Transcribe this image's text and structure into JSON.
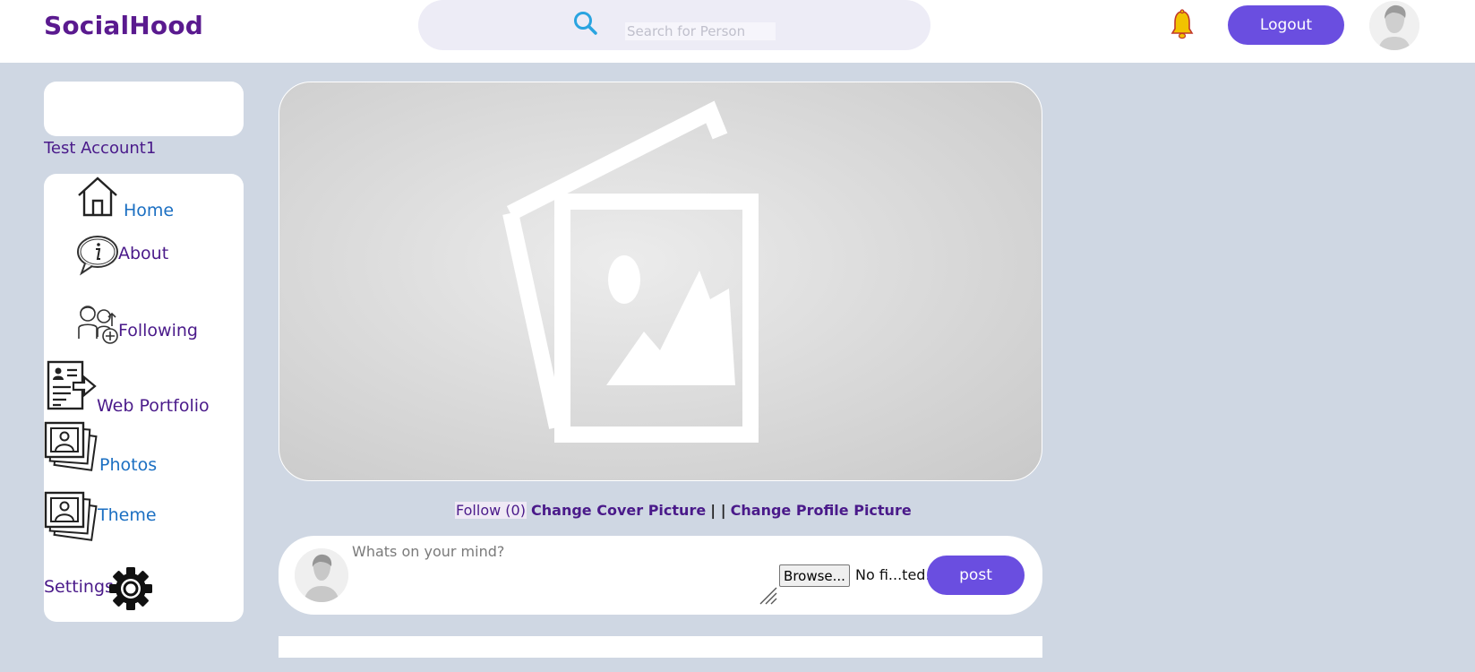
{
  "brand": "SocialHood",
  "search": {
    "placeholder": "Search for Person",
    "icon": "search-icon"
  },
  "header": {
    "logout_label": "Logout",
    "bell_icon": "notification-bell-icon",
    "avatar_icon": "user-avatar"
  },
  "sidebar": {
    "account_name": "Test Account1",
    "items": [
      {
        "label": "Home",
        "icon": "home-icon"
      },
      {
        "label": "About",
        "icon": "info-bubble-icon"
      },
      {
        "label": "Following",
        "icon": "following-people-icon"
      },
      {
        "label": "Web Portfolio",
        "icon": "portfolio-document-icon"
      },
      {
        "label": "Photos",
        "icon": "photos-stack-icon"
      },
      {
        "label": "Theme",
        "icon": "theme-photos-icon"
      },
      {
        "label": "Settings",
        "icon": "gear-icon"
      }
    ]
  },
  "profile": {
    "follow_label": "Follow (0)",
    "change_cover_label": "Change Cover Picture",
    "separator": "| |",
    "change_profile_label": "Change Profile Picture"
  },
  "composer": {
    "placeholder": "Whats on your mind?",
    "browse_label": "Browse...",
    "file_status": "No fi...ted.",
    "post_label": "post"
  },
  "colors": {
    "brand": "#5a1a8f",
    "accent": "#6a4ee0",
    "page_bg": "#cfd7e3",
    "link_blue": "#1b6fc2"
  }
}
